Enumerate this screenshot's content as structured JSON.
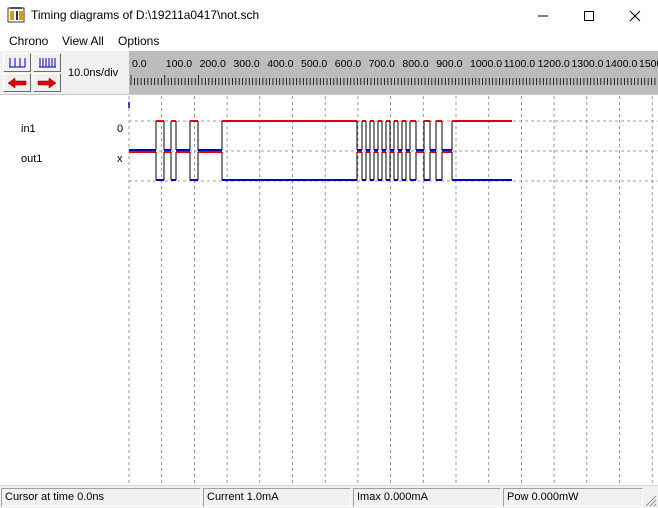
{
  "window": {
    "title": "Timing diagrams of D:\\19211a0417\\not.sch",
    "icon_name": "microwind-chip-icon"
  },
  "menu": {
    "items": [
      {
        "label": "Chrono"
      },
      {
        "label": "View All"
      },
      {
        "label": "Options"
      }
    ]
  },
  "toolbar": {
    "scale_label": "10.0ns/div",
    "zoom_in_icon": "zoom-in-ticks-icon",
    "zoom_out_icon": "zoom-out-ticks-icon",
    "scroll_left_icon": "red-left-arrow-icon",
    "scroll_right_icon": "red-right-arrow-icon"
  },
  "ruler": {
    "labels": [
      "0.0",
      "100.0",
      "200.0",
      "300.0",
      "400.0",
      "500.0",
      "600.0",
      "700.0",
      "800.0",
      "900.0",
      "1000.0",
      "1100.0",
      "1200.0",
      "1300.0",
      "1400.0",
      "1500.0"
    ]
  },
  "signals": [
    {
      "name": "in1",
      "value": "0"
    },
    {
      "name": "out1",
      "value": "x"
    }
  ],
  "colors": {
    "high_level": "#e00000",
    "low_level": "#0000c0",
    "grid": "#808080"
  },
  "statusbar": {
    "cursor": "Cursor at time  0.0ns",
    "current": "Current  1.0mA",
    "imax": "Imax 0.000mA",
    "power": "Pow 0.000mW"
  }
}
